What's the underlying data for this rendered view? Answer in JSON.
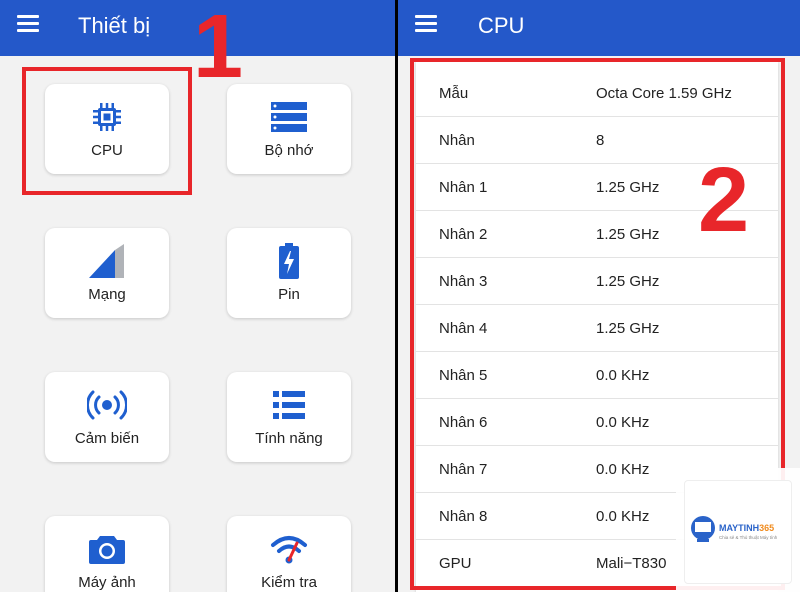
{
  "left_screen": {
    "title": "Thiết bị",
    "tiles": [
      {
        "label": "CPU",
        "icon": "cpu-icon"
      },
      {
        "label": "Bộ nhớ",
        "icon": "memory-icon"
      },
      {
        "label": "Mạng",
        "icon": "signal-icon"
      },
      {
        "label": "Pin",
        "icon": "battery-icon"
      },
      {
        "label": "Cảm biến",
        "icon": "sensor-icon"
      },
      {
        "label": "Tính năng",
        "icon": "features-icon"
      },
      {
        "label": "Máy ảnh",
        "icon": "camera-icon"
      },
      {
        "label": "Kiểm tra",
        "icon": "test-icon"
      }
    ],
    "callout_number": "1"
  },
  "right_screen": {
    "title": "CPU",
    "rows": [
      {
        "key": "Mẫu",
        "value": "Octa Core 1.59 GHz"
      },
      {
        "key": "Nhân",
        "value": "8"
      },
      {
        "key": "Nhân 1",
        "value": "1.25 GHz"
      },
      {
        "key": "Nhân 2",
        "value": "1.25 GHz"
      },
      {
        "key": "Nhân 3",
        "value": "1.25 GHz"
      },
      {
        "key": "Nhân 4",
        "value": "1.25 GHz"
      },
      {
        "key": "Nhân 5",
        "value": "0.0 KHz"
      },
      {
        "key": "Nhân 6",
        "value": "0.0 KHz"
      },
      {
        "key": "Nhân 7",
        "value": "0.0 KHz"
      },
      {
        "key": "Nhân 8",
        "value": "0.0 KHz"
      },
      {
        "key": "GPU",
        "value": "Mali−T830"
      }
    ],
    "callout_number": "2"
  },
  "watermark": {
    "brand_main": "MAYTINH",
    "brand_num": "365",
    "tagline": "Chia sẻ & Thủ thuật Máy tính"
  },
  "colors": {
    "appbar": "#2458c9",
    "icon_blue": "#1f5fcf",
    "callout_red": "#e8262a",
    "background": "#f2f2f2"
  }
}
